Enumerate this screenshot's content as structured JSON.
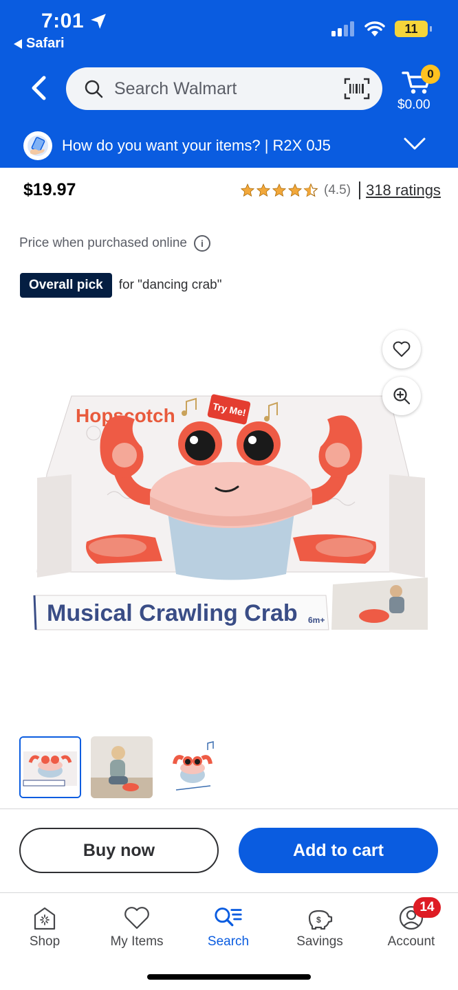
{
  "status_bar": {
    "time": "7:01",
    "back_app": "Safari",
    "battery": "11"
  },
  "header": {
    "search_placeholder": "Search Walmart",
    "cart_count": "0",
    "cart_total": "$0.00",
    "delivery_prompt": "How do you want your items? | R2X 0J5"
  },
  "product": {
    "price": "$19.97",
    "rating_value": "(4.5)",
    "rating_count_link": "318 ratings",
    "stars": 4.5,
    "price_note": "Price when purchased online",
    "badge_label": "Overall pick",
    "badge_context": "for \"dancing crab\"",
    "box_title": "Musical Crawling Crab",
    "box_age": "6m+",
    "box_brand": "Hopscotch",
    "box_sticker": "Try Me!"
  },
  "actions": {
    "buy_now": "Buy now",
    "add_to_cart": "Add to cart"
  },
  "bottom_nav": {
    "items": [
      {
        "label": "Shop",
        "icon": "store-icon"
      },
      {
        "label": "My Items",
        "icon": "heart-icon"
      },
      {
        "label": "Search",
        "icon": "search-list-icon"
      },
      {
        "label": "Savings",
        "icon": "piggy-bank-icon"
      },
      {
        "label": "Account",
        "icon": "account-icon"
      }
    ],
    "active": "Search",
    "account_badge": "14"
  },
  "colors": {
    "brand_blue": "#0a5ce0",
    "spark_yellow": "#ffc220",
    "badge_navy": "#041e42",
    "alert_red": "#de1c24"
  }
}
